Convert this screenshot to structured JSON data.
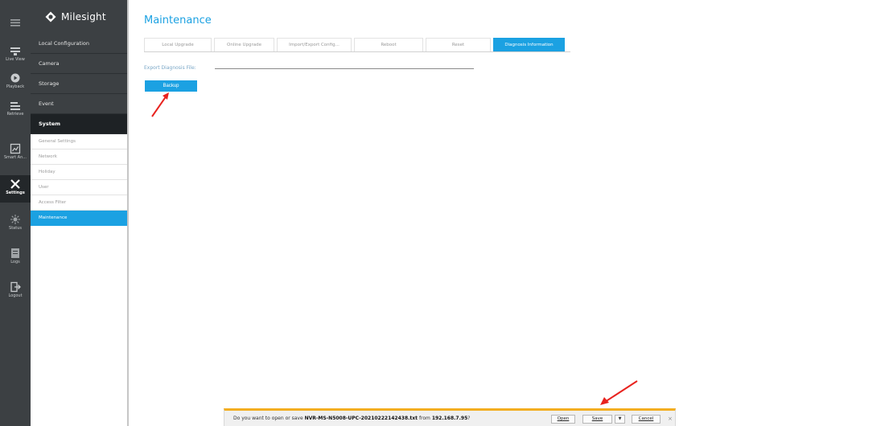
{
  "brand": {
    "logo_text": "Milesight"
  },
  "rail": [
    {
      "name": "menu-toggle",
      "label": "",
      "icon": "menu-icon"
    },
    {
      "name": "live-view",
      "label": "Live View",
      "icon": "live-view-icon"
    },
    {
      "name": "playback",
      "label": "Playback",
      "icon": "playback-icon"
    },
    {
      "name": "retrieve",
      "label": "Retrieve",
      "icon": "retrieve-icon"
    },
    {
      "name": "smart-analysis",
      "label": "Smart An...",
      "icon": "smart-analysis-icon"
    },
    {
      "name": "settings",
      "label": "Settings",
      "icon": "settings-icon"
    },
    {
      "name": "status",
      "label": "Status",
      "icon": "status-icon"
    },
    {
      "name": "logs",
      "label": "Logs",
      "icon": "logs-icon"
    },
    {
      "name": "logout",
      "label": "Logout",
      "icon": "logout-icon"
    }
  ],
  "menu": {
    "local_configuration": "Local Configuration",
    "camera": "Camera",
    "storage": "Storage",
    "event": "Event",
    "system": "System",
    "system_items": [
      "General Settings",
      "Network",
      "Holiday",
      "User",
      "Access Filter",
      "Maintenance"
    ]
  },
  "page": {
    "title": "Maintenance",
    "tabs": [
      "Local Upgrade",
      "Online Upgrade",
      "Import/Export Config...",
      "Reboot",
      "Reset",
      "Diagnosis Information"
    ],
    "export_label": "Export Diagnosis File:",
    "backup_label": "Backup"
  },
  "download_bar": {
    "prefix": "Do you want to open or save",
    "file": "NVR-MS-N5008-UPC-20210222142438.txt",
    "from_text": "from",
    "host": "192.168.7.95",
    "suffix": "?",
    "open_label": "Open",
    "save_label": "Save",
    "dropdown": "▼",
    "cancel_label": "Cancel",
    "close": "×"
  },
  "colors": {
    "accent": "#1ba1e2",
    "sidebar": "#3c4043",
    "annotation": "#e8231f",
    "notification": "#f3ae21"
  }
}
